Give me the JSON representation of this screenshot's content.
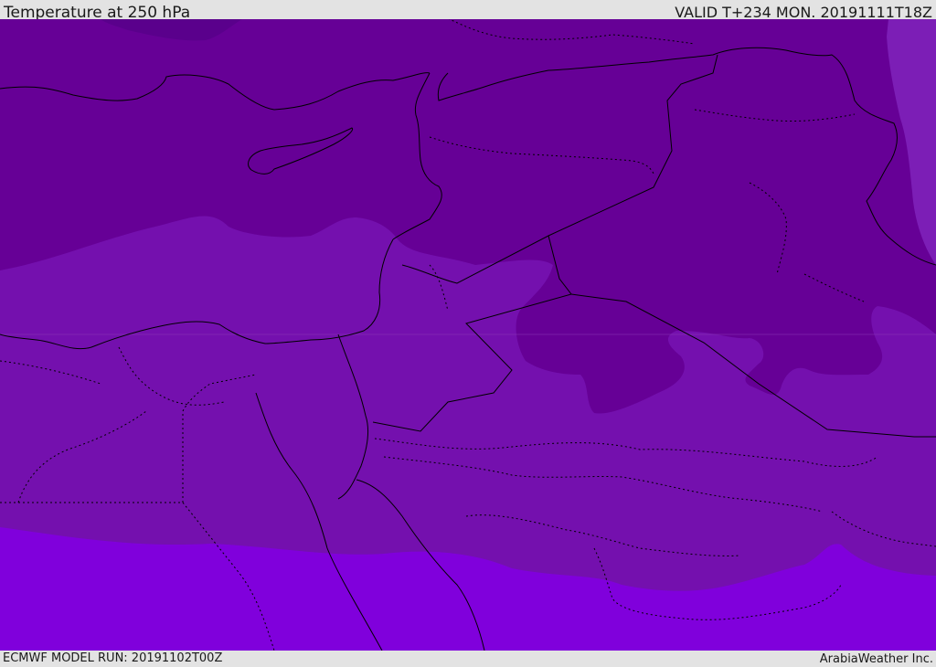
{
  "header": {
    "title": "Temperature at 250 hPa",
    "valid": "VALID T+234 MON. 20191111T18Z"
  },
  "footer": {
    "model_run": "ECMWF MODEL RUN: 20191102T00Z",
    "credit": "ArabiaWeather Inc."
  },
  "colors": {
    "band_coldest": "#5a008c",
    "band_cold": "#660096",
    "band_mid": "#7410ae",
    "band_warm": "#7f00dc",
    "band_light": "#7c1eb6",
    "border_line": "#000000"
  }
}
